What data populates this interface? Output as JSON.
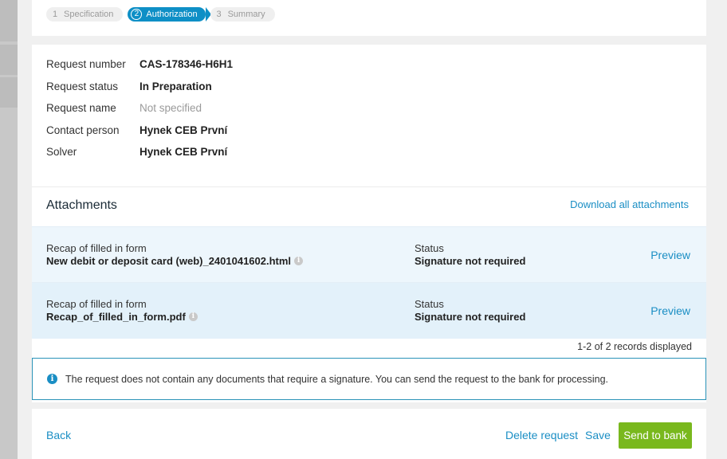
{
  "steps": [
    {
      "number": "1",
      "label": "Specification"
    },
    {
      "number": "2",
      "label": "Authorization"
    },
    {
      "number": "3",
      "label": "Summary"
    }
  ],
  "details": {
    "request_number": {
      "label": "Request number",
      "value": "CAS-178346-H6H1"
    },
    "request_status": {
      "label": "Request status",
      "value": "In Preparation"
    },
    "request_name": {
      "label": "Request name",
      "value": "Not specified"
    },
    "contact_person": {
      "label": "Contact person",
      "value": "Hynek CEB První"
    },
    "solver": {
      "label": "Solver",
      "value": "Hynek CEB První"
    }
  },
  "attachments": {
    "title": "Attachments",
    "download_all": "Download all attachments",
    "items": [
      {
        "caption": "Recap of filled in form",
        "filename": "New debit or deposit card (web)_2401041602.html",
        "status_label": "Status",
        "status_value": "Signature not required",
        "preview": "Preview"
      },
      {
        "caption": "Recap of filled in form",
        "filename": "Recap_of_filled_in_form.pdf",
        "status_label": "Status",
        "status_value": "Signature not required",
        "preview": "Preview"
      }
    ],
    "records": "1-2 of 2 records displayed"
  },
  "notice": {
    "icon_glyph": "i",
    "message": "The request does not contain any documents that require a signature. You can send the request to the bank for processing."
  },
  "footer": {
    "back": "Back",
    "delete": "Delete request",
    "save": "Save",
    "send": "Send to bank"
  },
  "colors": {
    "accent": "#1a8ec4",
    "primary_button": "#79b81d",
    "active_step": "#0e8fc6"
  }
}
